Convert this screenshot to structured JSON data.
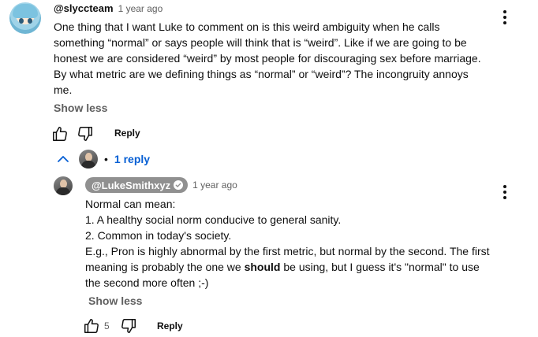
{
  "comment": {
    "handle": "@slyccteam",
    "time": "1 year ago",
    "lines": [
      "One thing that I want Luke to comment on is this weird ambiguity when he calls",
      "something “normal” or says people will think that is “weird”. Like if we are going to be",
      "honest we are considered “weird” by most people for discouraging sex before marriage.",
      "By what metric are we defining things as “normal” or “weird”? The incongruity annoys",
      "me."
    ],
    "show_less": "Show less",
    "reply_label": "Reply"
  },
  "replies_toggle": {
    "separator": "•",
    "label": "1 reply"
  },
  "reply": {
    "handle": "@LukeSmithxyz",
    "time": "1 year ago",
    "lines": [
      "Normal can mean:",
      "1. A healthy social norm conducive to general sanity.",
      "2. Common in today's society.",
      "E.g., Pron is highly abnormal by the first metric, but normal by the second. The first"
    ],
    "line5_before": "meaning is probably the one we ",
    "line5_bold": "should",
    "line5_after": " be using, but I guess it's \"normal\" to use",
    "line6": "the second more often ;-)",
    "show_less": "Show less",
    "like_count": "5",
    "reply_label": "Reply"
  },
  "colors": {
    "text": "#0f0f0f",
    "secondary": "#606060",
    "link": "#065fd4",
    "owner_chip": "#909090"
  },
  "icons": {
    "like": "thumbs-up-icon",
    "dislike": "thumbs-down-icon",
    "more": "more-vertical-icon",
    "collapse": "chevron-up-icon",
    "verified": "verified-check-icon"
  }
}
